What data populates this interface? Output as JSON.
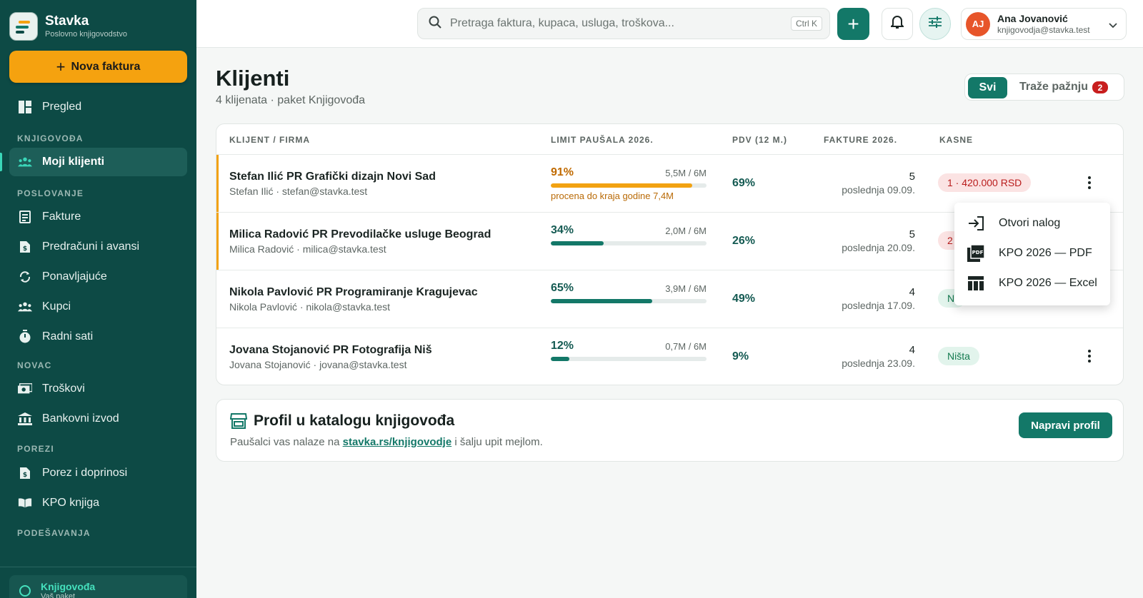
{
  "brand": {
    "name": "Stavka",
    "subtitle": "Poslovno knjigovodstvo"
  },
  "sidebar": {
    "new_invoice": "Nova faktura",
    "overview": "Pregled",
    "sections": {
      "accountant": "KNJIGOVOĐA",
      "business": "POSLOVANJE",
      "money": "NOVAC",
      "taxes": "POREZI",
      "settings": "PODEŠAVANJA"
    },
    "items": {
      "my_clients": "Moji klijenti",
      "invoices": "Fakture",
      "proforma": "Predračuni i avansi",
      "recurring": "Ponavljajuće",
      "customers": "Kupci",
      "work_hours": "Radni sati",
      "expenses": "Troškovi",
      "bank_statement": "Bankovni izvod",
      "tax": "Porez i doprinosi",
      "kpo": "KPO knjiga"
    },
    "plan": {
      "title": "Knjigovođa",
      "subtitle": "Vaš paket"
    }
  },
  "topbar": {
    "search_placeholder": "Pretraga faktura, kupaca, usluga, troškova...",
    "shortcut": "Ctrl K",
    "add_label": "+",
    "user": {
      "initials": "AJ",
      "name": "Ana Jovanović",
      "email": "knjigovodja@stavka.test"
    }
  },
  "page": {
    "title": "Klijenti",
    "subtitle": "4 klijenata · paket Knjigovođa",
    "filter_all": "Svi",
    "filter_attention": "Traže pažnju",
    "attention_count": "2"
  },
  "table": {
    "headers": {
      "client": "KLIJENT / FIRMA",
      "limit": "LIMIT PAUŠALA 2026.",
      "pdv": "PDV (12 M.)",
      "invoices": "FAKTURE 2026.",
      "late": "KASNE"
    },
    "rows": [
      {
        "name": "Stefan Ilić PR Grafički dizajn Novi Sad",
        "contact": "Stefan Ilić · stefan@stavka.test",
        "pct": "91%",
        "fill": 0.91,
        "limit": "5,5M / 6M",
        "estimate": "procena do kraja godine 7,4M",
        "pdv": "69%",
        "invoices": "5",
        "last": "poslednja 09.09.",
        "late": "1 · 420.000 RSD"
      },
      {
        "name": "Milica Radović PR Prevodilačke usluge Beograd",
        "contact": "Milica Radović · milica@stavka.test",
        "pct": "34%",
        "fill": 0.34,
        "limit": "2,0M / 6M",
        "estimate": "",
        "pdv": "26%",
        "invoices": "5",
        "last": "poslednja 20.09.",
        "late": "2"
      },
      {
        "name": "Nikola Pavlović PR Programiranje Kragujevac",
        "contact": "Nikola Pavlović · nikola@stavka.test",
        "pct": "65%",
        "fill": 0.65,
        "limit": "3,9M / 6M",
        "estimate": "",
        "pdv": "49%",
        "invoices": "4",
        "last": "poslednja 17.09.",
        "late": "Ni"
      },
      {
        "name": "Jovana Stojanović PR Fotografija Niš",
        "contact": "Jovana Stojanović · jovana@stavka.test",
        "pct": "12%",
        "fill": 0.12,
        "limit": "0,7M / 6M",
        "estimate": "",
        "pdv": "9%",
        "invoices": "4",
        "last": "poslednja 23.09.",
        "late": "Ništa"
      }
    ]
  },
  "menu": {
    "open_account": "Otvori nalog",
    "kpo_pdf": "KPO 2026 — PDF",
    "kpo_excel": "KPO 2026 — Excel"
  },
  "profile": {
    "title": "Profil u katalogu knjigovođa",
    "text_before": "Paušalci vas nalaze na ",
    "link": "stavka.rs/knjigovodje",
    "text_after": " i šalju upit mejlom.",
    "button": "Napravi profil"
  },
  "colors": {
    "sidebar": "#0d4a45",
    "accent": "#137868",
    "warning": "#f5a20f",
    "danger": "#c81e1e"
  }
}
